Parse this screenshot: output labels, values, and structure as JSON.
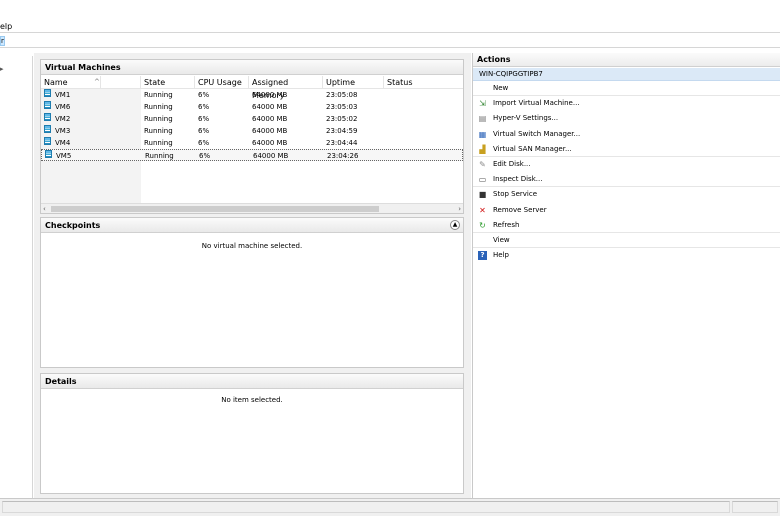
{
  "menubar": {
    "help_label": "elp"
  },
  "address": {
    "fragment": "n"
  },
  "vm_panel": {
    "title": "Virtual Machines",
    "columns": [
      "Name",
      "State",
      "CPU Usage",
      "Assigned Memory",
      "Uptime",
      "Status"
    ],
    "rows": [
      {
        "name": "VM1",
        "state": "Running",
        "cpu": "6%",
        "memory": "64000 MB",
        "uptime": "23:05:08",
        "status": ""
      },
      {
        "name": "VM6",
        "state": "Running",
        "cpu": "6%",
        "memory": "64000 MB",
        "uptime": "23:05:03",
        "status": ""
      },
      {
        "name": "VM2",
        "state": "Running",
        "cpu": "6%",
        "memory": "64000 MB",
        "uptime": "23:05:02",
        "status": ""
      },
      {
        "name": "VM3",
        "state": "Running",
        "cpu": "6%",
        "memory": "64000 MB",
        "uptime": "23:04:59",
        "status": ""
      },
      {
        "name": "VM4",
        "state": "Running",
        "cpu": "6%",
        "memory": "64000 MB",
        "uptime": "23:04:44",
        "status": ""
      },
      {
        "name": "VM5",
        "state": "Running",
        "cpu": "6%",
        "memory": "64000 MB",
        "uptime": "23:04:26",
        "status": ""
      }
    ],
    "selected_row": "VM5"
  },
  "checkpoints_panel": {
    "title": "Checkpoints",
    "empty_message": "No virtual machine selected."
  },
  "details_panel": {
    "title": "Details",
    "empty_message": "No item selected."
  },
  "actions_panel": {
    "title": "Actions",
    "host": "WIN-CQIPGGTIPB7",
    "items": [
      {
        "label": "New",
        "icon": "none"
      },
      {
        "label": "Import Virtual Machine...",
        "icon": "import-icon"
      },
      {
        "label": "Hyper-V Settings...",
        "icon": "settings-page-icon"
      },
      {
        "label": "Virtual Switch Manager...",
        "icon": "switch-icon"
      },
      {
        "label": "Virtual SAN Manager...",
        "icon": "san-icon"
      },
      {
        "label": "Edit Disk...",
        "icon": "edit-disk-icon"
      },
      {
        "label": "Inspect Disk...",
        "icon": "inspect-disk-icon"
      },
      {
        "label": "Stop Service",
        "icon": "stop-icon"
      },
      {
        "label": "Remove Server",
        "icon": "remove-icon"
      },
      {
        "label": "Refresh",
        "icon": "refresh-icon"
      },
      {
        "label": "View",
        "icon": "none"
      },
      {
        "label": "Help",
        "icon": "help-icon"
      }
    ]
  },
  "colors": {
    "selection": "#dbe9f7",
    "panel_bg": "#f0f0f0",
    "vm_icon": "#3aa9d6",
    "stop_red": "#d01010",
    "refresh_green": "#2a9a2a",
    "help_blue": "#2a62b8"
  }
}
